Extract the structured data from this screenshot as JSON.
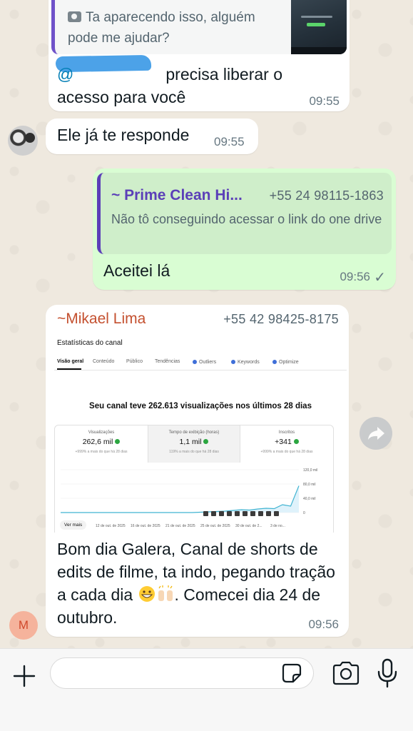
{
  "messages": [
    {
      "quote_text": "Ta aparecendo isso, alguém pode me ajudar?",
      "mention": "@",
      "text": "precisa liberar o acesso para você",
      "time": "09:55"
    },
    {
      "text": "Ele já te responde",
      "time": "09:55"
    },
    {
      "quote_name": "~ Prime Clean Hi...",
      "quote_phone": "+55 24 98115-1863",
      "quote_text": "Não tô conseguindo acessar o link do one drive",
      "text": "Aceitei lá",
      "time": "09:56"
    },
    {
      "sender": "~Mikael Lima",
      "phone": "+55 42 98425-8175",
      "text_part1": "Bom dia Galera, Canal de shorts de edits de filme, ta indo, pegando tração a cada dia",
      "text_part2": ". Comecei dia 24 de outubro.",
      "time": "09:56",
      "avatar_letter": "M"
    }
  ],
  "screenshot": {
    "title": "Estatísticas do canal",
    "tabs": [
      "Visão geral",
      "Conteúdo",
      "Público",
      "Tendências",
      "Outliers",
      "Keywords",
      "Optimize"
    ],
    "headline": "Seu canal teve 262.613 visualizações nos últimos 28 dias",
    "stats": [
      {
        "label": "Visualizações",
        "value": "262,6 mil",
        "sub": "+999% a mais do que há 28 dias"
      },
      {
        "label": "Tempo de exibição (horas)",
        "value": "1,1 mil",
        "sub": "119% a mais do que há 28 dias"
      },
      {
        "label": "Inscritos",
        "value": "+341",
        "sub": "+999% a mais do que há 28 dias"
      }
    ],
    "more_button": "Ver mais",
    "chart_data": {
      "type": "area",
      "x_ticks": [
        "7 de out.",
        "12 de out. de 2025",
        "16 de out. de 2025",
        "21 de out. de 2025",
        "25 de out. de 2025",
        "30 de out. de 2...",
        "3 de no..."
      ],
      "y_ticks": [
        "120,0 mil",
        "80,0 mil",
        "40,0 mil",
        "0"
      ],
      "values": [
        0,
        0,
        0,
        0,
        0,
        0,
        0,
        0,
        0,
        0,
        0,
        0,
        0,
        0,
        0,
        0,
        0,
        1,
        2,
        3,
        4,
        6,
        8,
        7,
        10,
        12,
        11,
        22,
        18,
        75
      ],
      "ylim": [
        0,
        120
      ]
    }
  },
  "composer": {
    "placeholder": ""
  },
  "colors": {
    "outgoing": "#d9fdd3",
    "incoming": "#ffffff",
    "quote_name": "#5b3fb8",
    "sender": "#c4502f"
  }
}
